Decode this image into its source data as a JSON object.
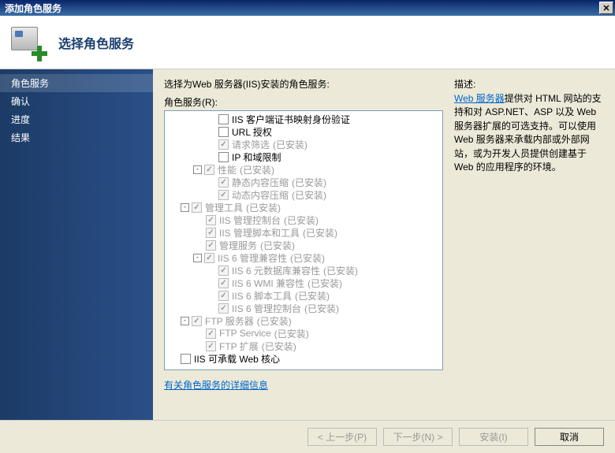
{
  "window": {
    "title": "添加角色服务"
  },
  "header": {
    "title": "选择角色服务"
  },
  "sidebar": {
    "items": [
      {
        "label": "角色服务",
        "active": true
      },
      {
        "label": "确认",
        "active": false
      },
      {
        "label": "进度",
        "active": false
      },
      {
        "label": "结果",
        "active": false
      }
    ]
  },
  "main": {
    "instruction": "选择为Web 服务器(IIS)安装的角色服务:",
    "sublabel": "角色服务(R):",
    "tree": [
      {
        "depth": 4,
        "toggle": "",
        "checked": false,
        "disabled": false,
        "label": "IIS 客户端证书映射身份验证",
        "status": ""
      },
      {
        "depth": 4,
        "toggle": "",
        "checked": false,
        "disabled": false,
        "label": "URL 授权",
        "status": ""
      },
      {
        "depth": 4,
        "toggle": "",
        "checked": true,
        "disabled": true,
        "label": "请求筛选",
        "status": "(已安装)"
      },
      {
        "depth": 4,
        "toggle": "",
        "checked": false,
        "disabled": false,
        "label": "IP 和域限制",
        "status": ""
      },
      {
        "depth": 2,
        "toggle": "-",
        "checked": true,
        "disabled": true,
        "label": "性能",
        "status": "(已安装)"
      },
      {
        "depth": 4,
        "toggle": "",
        "checked": true,
        "disabled": true,
        "label": "静态内容压缩",
        "status": "(已安装)"
      },
      {
        "depth": 4,
        "toggle": "",
        "checked": true,
        "disabled": true,
        "label": "动态内容压缩",
        "status": "(已安装)"
      },
      {
        "depth": 1,
        "toggle": "-",
        "checked": true,
        "disabled": true,
        "label": "管理工具",
        "status": "(已安装)"
      },
      {
        "depth": 3,
        "toggle": "",
        "checked": true,
        "disabled": true,
        "label": "IIS 管理控制台",
        "status": "(已安装)"
      },
      {
        "depth": 3,
        "toggle": "",
        "checked": true,
        "disabled": true,
        "label": "IIS 管理脚本和工具",
        "status": "(已安装)"
      },
      {
        "depth": 3,
        "toggle": "",
        "checked": true,
        "disabled": true,
        "label": "管理服务",
        "status": "(已安装)"
      },
      {
        "depth": 2,
        "toggle": "-",
        "checked": true,
        "disabled": true,
        "label": "IIS 6 管理兼容性",
        "status": "(已安装)"
      },
      {
        "depth": 4,
        "toggle": "",
        "checked": true,
        "disabled": true,
        "label": "IIS 6 元数据库兼容性",
        "status": "(已安装)"
      },
      {
        "depth": 4,
        "toggle": "",
        "checked": true,
        "disabled": true,
        "label": "IIS 6 WMI 兼容性",
        "status": "(已安装)"
      },
      {
        "depth": 4,
        "toggle": "",
        "checked": true,
        "disabled": true,
        "label": "IIS 6 脚本工具",
        "status": "(已安装)"
      },
      {
        "depth": 4,
        "toggle": "",
        "checked": true,
        "disabled": true,
        "label": "IIS 6 管理控制台",
        "status": "(已安装)"
      },
      {
        "depth": 1,
        "toggle": "-",
        "checked": true,
        "disabled": true,
        "label": "FTP 服务器",
        "status": "(已安装)"
      },
      {
        "depth": 3,
        "toggle": "",
        "checked": true,
        "disabled": true,
        "label": "FTP Service",
        "status": "(已安装)"
      },
      {
        "depth": 3,
        "toggle": "",
        "checked": true,
        "disabled": true,
        "label": "FTP 扩展",
        "status": "(已安装)"
      },
      {
        "depth": 1,
        "toggle": "",
        "checked": false,
        "disabled": false,
        "label": "IIS 可承载 Web 核心",
        "status": ""
      }
    ],
    "moreLink": "有关角色服务的详细信息"
  },
  "desc": {
    "heading": "描述:",
    "linkText": "Web 服务器",
    "rest": "提供对 HTML 网站的支持和对 ASP.NET、ASP 以及 Web 服务器扩展的可选支持。可以使用 Web 服务器来承载内部或外部网站，或为开发人员提供创建基于 Web 的应用程序的环境。"
  },
  "footer": {
    "prev": "< 上一步(P)",
    "next": "下一步(N) >",
    "install": "安装(I)",
    "cancel": "取消"
  }
}
